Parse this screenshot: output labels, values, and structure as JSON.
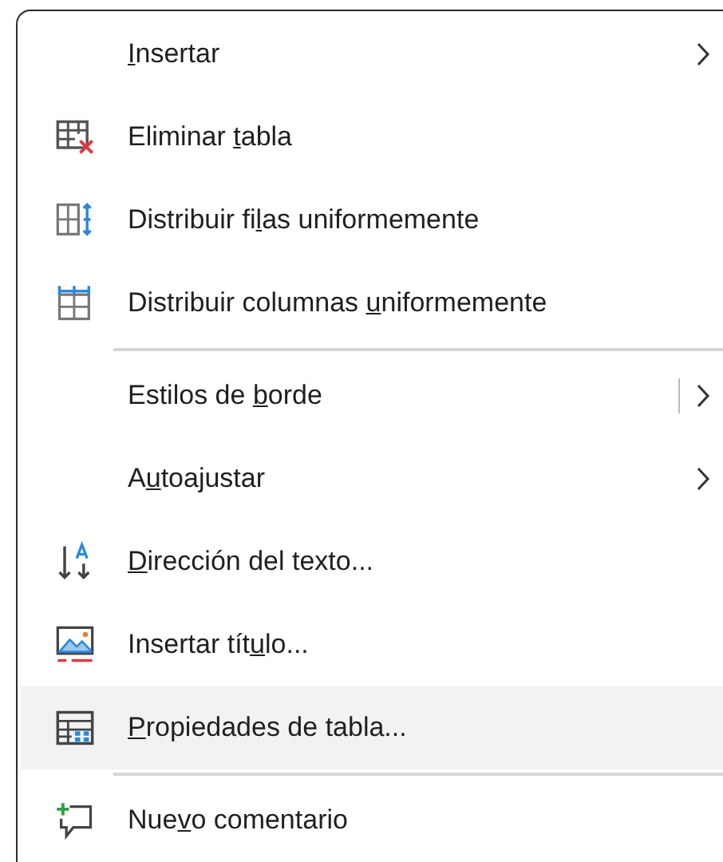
{
  "menu": {
    "items": [
      {
        "kind": "item",
        "access_key": "I",
        "text_after": "nsertar",
        "submenu": true,
        "split": false,
        "selected": false
      },
      {
        "kind": "item",
        "text_before": "Eliminar ",
        "access_key": "t",
        "text_after": "abla",
        "submenu": false,
        "split": false,
        "selected": false
      },
      {
        "kind": "item",
        "text_before": "Distribuir fi",
        "access_key": "l",
        "text_after": "as uniformemente",
        "submenu": false,
        "split": false,
        "selected": false
      },
      {
        "kind": "item",
        "text_before": "Distribuir columnas ",
        "access_key": "u",
        "text_after": "niformemente",
        "submenu": false,
        "split": false,
        "selected": false
      },
      {
        "kind": "separator"
      },
      {
        "kind": "item",
        "text_before": "Estilos de ",
        "access_key": "b",
        "text_after": "orde",
        "submenu": true,
        "split": true,
        "selected": false
      },
      {
        "kind": "item",
        "text_before": "A",
        "access_key": "u",
        "text_after": "toajustar",
        "submenu": true,
        "split": false,
        "selected": false
      },
      {
        "kind": "item",
        "access_key": "D",
        "text_after": "irección del texto...",
        "submenu": false,
        "split": false,
        "selected": false
      },
      {
        "kind": "item",
        "text_before": "Insertar tít",
        "access_key": "u",
        "text_after": "lo...",
        "submenu": false,
        "split": false,
        "selected": false
      },
      {
        "kind": "item",
        "access_key": "P",
        "text_after": "ropiedades de tabla...",
        "submenu": false,
        "split": false,
        "selected": true
      },
      {
        "kind": "separator"
      },
      {
        "kind": "item",
        "text_before": "Nue",
        "access_key": "v",
        "text_after": "o comentario",
        "submenu": false,
        "split": false,
        "selected": false
      }
    ]
  }
}
